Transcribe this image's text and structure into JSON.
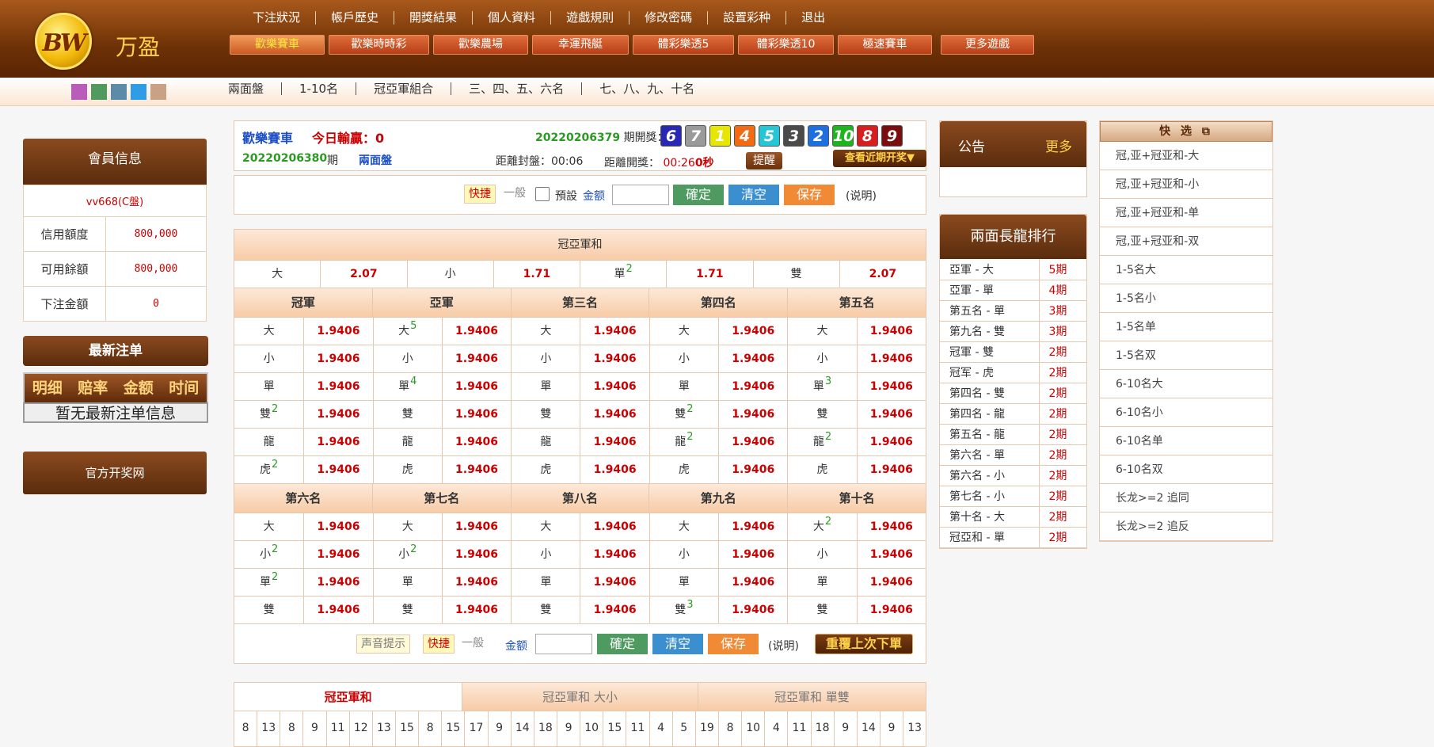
{
  "brand": {
    "logo_text": "BW",
    "name": "万盈"
  },
  "topmenu": [
    "下注狀況",
    "帳戶歷史",
    "開獎結果",
    "個人資料",
    "遊戲規則",
    "修改密碼",
    "設置彩种",
    "退出"
  ],
  "gametabs": [
    {
      "label": "歡樂賽車",
      "active": true
    },
    {
      "label": "歡樂時時彩",
      "active": false
    },
    {
      "label": "歡樂農場",
      "active": false
    },
    {
      "label": "幸運飛艇",
      "active": false
    },
    {
      "label": "體彩樂透5",
      "active": false
    },
    {
      "label": "體彩樂透10",
      "active": false
    },
    {
      "label": "極速賽車",
      "active": false
    },
    {
      "label": "更多遊戲",
      "active": false
    }
  ],
  "swatch_colors": [
    "#b85eb8",
    "#4f9a5c",
    "#5b8ba6",
    "#2f9de6",
    "#c8a283"
  ],
  "subnav": [
    "兩面盤",
    "1-10名",
    "冠亞軍組合",
    "三、四、五、六名",
    "七、八、九、十名"
  ],
  "member": {
    "title": "會員信息",
    "username": "vv668(C盤)",
    "rows": [
      {
        "label": "信用額度",
        "value": "800,000"
      },
      {
        "label": "可用餘額",
        "value": "800,000"
      },
      {
        "label": "下注金額",
        "value": "0"
      }
    ]
  },
  "latest": {
    "title": "最新注单",
    "columns": [
      "明细",
      "赔率",
      "金额",
      "时间"
    ],
    "empty": "暂无最新注单信息"
  },
  "official": "官方开奖网",
  "info": {
    "game": "歡樂賽車",
    "win_label": "今日輸贏：0",
    "last_period": "20220206379",
    "last_period_label": "期開獎：",
    "balls": [
      {
        "n": "6",
        "color": "#2828b4"
      },
      {
        "n": "7",
        "color": "#9a9a9a"
      },
      {
        "n": "1",
        "color": "#e6e600"
      },
      {
        "n": "4",
        "color": "#f26b12"
      },
      {
        "n": "5",
        "color": "#27c6d6"
      },
      {
        "n": "3",
        "color": "#4a4a4a"
      },
      {
        "n": "2",
        "color": "#1e6fe0"
      },
      {
        "n": "10",
        "color": "#1db51d"
      },
      {
        "n": "8",
        "color": "#d81e1e"
      },
      {
        "n": "9",
        "color": "#7a0e0e"
      }
    ],
    "current_period": "20220206380",
    "period_suffix": "期",
    "market": "兩面盤",
    "close_label": "距離封盤：00:06",
    "open_label": "距離開獎：",
    "open_time": "00:26",
    "open_seconds": "0秒",
    "remind": "提醒",
    "recent": "查看近期开奖▼"
  },
  "actions": {
    "quick": "快捷",
    "normal": "一般",
    "preset": "預設",
    "amount": "金额",
    "ok": "確定",
    "clear": "清空",
    "save": "保存",
    "explain": "(说明)",
    "sound": "声音提示",
    "repeat": "重覆上次下單"
  },
  "sum_section": {
    "title": "冠亞軍和",
    "items": [
      {
        "k": "大",
        "o": "2.07",
        "sup": ""
      },
      {
        "k": "小",
        "o": "1.71",
        "sup": ""
      },
      {
        "k": "單",
        "o": "1.71",
        "sup": "2"
      },
      {
        "k": "雙",
        "o": "2.07",
        "sup": ""
      }
    ]
  },
  "group1": {
    "heads": [
      "冠軍",
      "亞軍",
      "第三名",
      "第四名",
      "第五名"
    ],
    "rows": [
      [
        {
          "k": "大",
          "s": "",
          "o": "1.9406"
        },
        {
          "k": "大",
          "s": "5",
          "o": "1.9406"
        },
        {
          "k": "大",
          "s": "",
          "o": "1.9406"
        },
        {
          "k": "大",
          "s": "",
          "o": "1.9406"
        },
        {
          "k": "大",
          "s": "",
          "o": "1.9406"
        }
      ],
      [
        {
          "k": "小",
          "s": "",
          "o": "1.9406"
        },
        {
          "k": "小",
          "s": "",
          "o": "1.9406"
        },
        {
          "k": "小",
          "s": "",
          "o": "1.9406"
        },
        {
          "k": "小",
          "s": "",
          "o": "1.9406"
        },
        {
          "k": "小",
          "s": "",
          "o": "1.9406"
        }
      ],
      [
        {
          "k": "單",
          "s": "",
          "o": "1.9406"
        },
        {
          "k": "單",
          "s": "4",
          "o": "1.9406"
        },
        {
          "k": "單",
          "s": "",
          "o": "1.9406"
        },
        {
          "k": "單",
          "s": "",
          "o": "1.9406"
        },
        {
          "k": "單",
          "s": "3",
          "o": "1.9406"
        }
      ],
      [
        {
          "k": "雙",
          "s": "2",
          "o": "1.9406"
        },
        {
          "k": "雙",
          "s": "",
          "o": "1.9406"
        },
        {
          "k": "雙",
          "s": "",
          "o": "1.9406"
        },
        {
          "k": "雙",
          "s": "2",
          "o": "1.9406"
        },
        {
          "k": "雙",
          "s": "",
          "o": "1.9406"
        }
      ],
      [
        {
          "k": "龍",
          "s": "",
          "o": "1.9406"
        },
        {
          "k": "龍",
          "s": "",
          "o": "1.9406"
        },
        {
          "k": "龍",
          "s": "",
          "o": "1.9406"
        },
        {
          "k": "龍",
          "s": "2",
          "o": "1.9406"
        },
        {
          "k": "龍",
          "s": "2",
          "o": "1.9406"
        }
      ],
      [
        {
          "k": "虎",
          "s": "2",
          "o": "1.9406"
        },
        {
          "k": "虎",
          "s": "",
          "o": "1.9406"
        },
        {
          "k": "虎",
          "s": "",
          "o": "1.9406"
        },
        {
          "k": "虎",
          "s": "",
          "o": "1.9406"
        },
        {
          "k": "虎",
          "s": "",
          "o": "1.9406"
        }
      ]
    ]
  },
  "group2": {
    "heads": [
      "第六名",
      "第七名",
      "第八名",
      "第九名",
      "第十名"
    ],
    "rows": [
      [
        {
          "k": "大",
          "s": "",
          "o": "1.9406"
        },
        {
          "k": "大",
          "s": "",
          "o": "1.9406"
        },
        {
          "k": "大",
          "s": "",
          "o": "1.9406"
        },
        {
          "k": "大",
          "s": "",
          "o": "1.9406"
        },
        {
          "k": "大",
          "s": "2",
          "o": "1.9406"
        }
      ],
      [
        {
          "k": "小",
          "s": "2",
          "o": "1.9406"
        },
        {
          "k": "小",
          "s": "2",
          "o": "1.9406"
        },
        {
          "k": "小",
          "s": "",
          "o": "1.9406"
        },
        {
          "k": "小",
          "s": "",
          "o": "1.9406"
        },
        {
          "k": "小",
          "s": "",
          "o": "1.9406"
        }
      ],
      [
        {
          "k": "單",
          "s": "2",
          "o": "1.9406"
        },
        {
          "k": "單",
          "s": "",
          "o": "1.9406"
        },
        {
          "k": "單",
          "s": "",
          "o": "1.9406"
        },
        {
          "k": "單",
          "s": "",
          "o": "1.9406"
        },
        {
          "k": "單",
          "s": "",
          "o": "1.9406"
        }
      ],
      [
        {
          "k": "雙",
          "s": "",
          "o": "1.9406"
        },
        {
          "k": "雙",
          "s": "",
          "o": "1.9406"
        },
        {
          "k": "雙",
          "s": "",
          "o": "1.9406"
        },
        {
          "k": "雙",
          "s": "3",
          "o": "1.9406"
        },
        {
          "k": "雙",
          "s": "",
          "o": "1.9406"
        }
      ]
    ]
  },
  "result_tabs": [
    {
      "label": "冠亞軍和",
      "active": true
    },
    {
      "label": "冠亞軍和 大小",
      "active": false
    },
    {
      "label": "冠亞軍和 單雙",
      "active": false
    }
  ],
  "sequence": [
    "8",
    "13",
    "8",
    "9",
    "11",
    "12",
    "13",
    "15",
    "8",
    "15",
    "17",
    "9",
    "14",
    "18",
    "9",
    "10",
    "15",
    "11",
    "4",
    "5",
    "19",
    "8",
    "10",
    "4",
    "11",
    "18",
    "9",
    "14",
    "9",
    "13"
  ],
  "notice": {
    "title": "公告",
    "more": "更多"
  },
  "dragon": {
    "title": "兩面長龍排行",
    "rows": [
      {
        "name": "亞軍 - 大",
        "count": "5期"
      },
      {
        "name": "亞軍 - 單",
        "count": "4期"
      },
      {
        "name": "第五名 - 單",
        "count": "3期"
      },
      {
        "name": "第九名 - 雙",
        "count": "3期"
      },
      {
        "name": "冠軍 - 雙",
        "count": "2期"
      },
      {
        "name": "冠军 - 虎",
        "count": "2期"
      },
      {
        "name": "第四名 - 雙",
        "count": "2期"
      },
      {
        "name": "第四名 - 龍",
        "count": "2期"
      },
      {
        "name": "第五名 - 龍",
        "count": "2期"
      },
      {
        "name": "第六名 - 單",
        "count": "2期"
      },
      {
        "name": "第六名 - 小",
        "count": "2期"
      },
      {
        "name": "第七名 - 小",
        "count": "2期"
      },
      {
        "name": "第十名 - 大",
        "count": "2期"
      },
      {
        "name": "冠亞和 - 單",
        "count": "2期"
      }
    ]
  },
  "quickpick": {
    "title": "快 选",
    "items": [
      "冠,亚+冠亚和-大",
      "冠,亚+冠亚和-小",
      "冠,亚+冠亚和-单",
      "冠,亚+冠亚和-双",
      "1-5名大",
      "1-5名小",
      "1-5名单",
      "1-5名双",
      "6-10名大",
      "6-10名小",
      "6-10名单",
      "6-10名双",
      "长龙>=2 追同",
      "长龙>=2 追反"
    ]
  }
}
